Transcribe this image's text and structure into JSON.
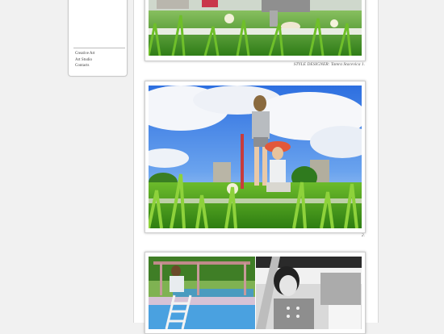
{
  "sidebar": {
    "links": [
      "Creative Art",
      "Art Studio",
      "Contacts"
    ]
  },
  "gallery": {
    "photo1_caption": "STYLE DESIGNER: Tamra Stacevica 1.",
    "photo2_caption": "2."
  },
  "colors": {
    "page_bg": "#f1f1f1",
    "content_bg": "#ffffff",
    "sky": "#3f7fe0",
    "grass": "#3f9a1e",
    "hat": "#e2583a"
  }
}
